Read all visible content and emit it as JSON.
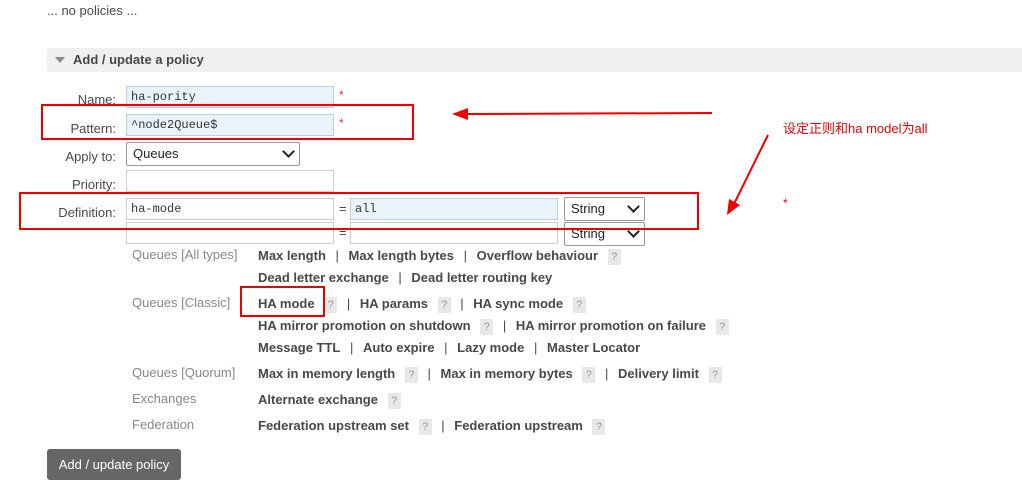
{
  "no_policies": "... no policies ...",
  "section_title": "Add / update a policy",
  "form": {
    "name_label": "Name:",
    "name_value": "ha-pority",
    "pattern_label": "Pattern:",
    "pattern_value": "^node2Queue$",
    "apply_to_label": "Apply to:",
    "apply_to_value": "Queues",
    "priority_label": "Priority:",
    "priority_value": "",
    "definition_label": "Definition:",
    "definitions": [
      {
        "key": "ha-mode",
        "value": "all",
        "type": "String"
      },
      {
        "key": "",
        "value": "",
        "type": "String"
      }
    ],
    "required_mark": "*",
    "equals": "="
  },
  "options": {
    "all_types": {
      "category": "Queues [All types]",
      "items": [
        "Max length",
        "Max length bytes",
        "Overflow behaviour",
        "Dead letter exchange",
        "Dead letter routing key"
      ]
    },
    "classic": {
      "category": "Queues [Classic]",
      "items": [
        "HA mode",
        "HA params",
        "HA sync mode",
        "HA mirror promotion on shutdown",
        "HA mirror promotion on failure",
        "Message TTL",
        "Auto expire",
        "Lazy mode",
        "Master Locator"
      ]
    },
    "quorum": {
      "category": "Queues [Quorum]",
      "items": [
        "Max in memory length",
        "Max in memory bytes",
        "Delivery limit"
      ]
    },
    "exchanges": {
      "category": "Exchanges",
      "items": [
        "Alternate exchange"
      ]
    },
    "federation": {
      "category": "Federation",
      "items": [
        "Federation upstream set",
        "Federation upstream"
      ]
    },
    "help_glyph": "?",
    "separator": "|"
  },
  "annotation": {
    "text": "设定正则和ha model为all",
    "stray_mark": "*"
  },
  "submit_label": "Add / update policy",
  "colors": {
    "annotation_red": "#e00000",
    "input_filled_bg": "#eaf3fb",
    "button_bg": "#666666"
  }
}
